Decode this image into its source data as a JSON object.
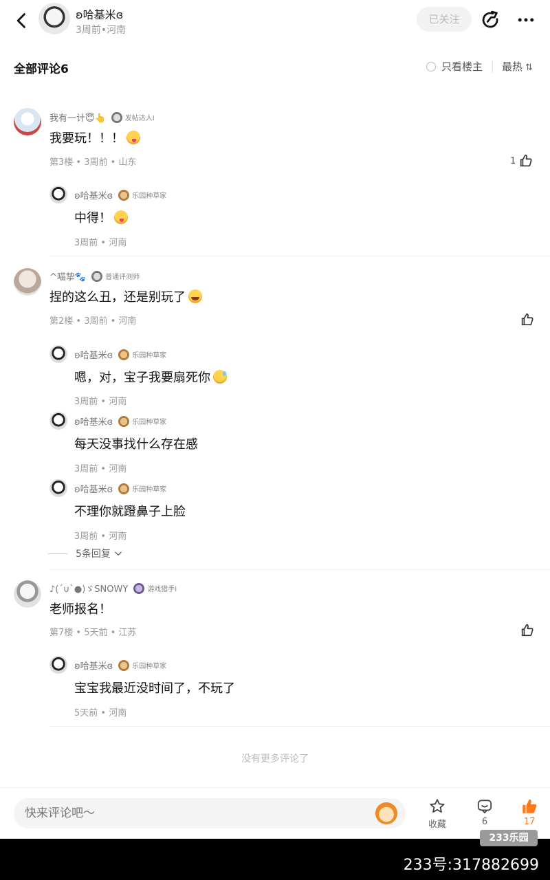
{
  "header": {
    "username": "ʚ哈基米ɞ",
    "meta": "3周前•河南",
    "follow_label": "已关注",
    "icons": [
      "back-icon",
      "share-icon",
      "more-icon"
    ]
  },
  "comments_header": {
    "title": "全部评论6",
    "only_owner": "只看楼主",
    "sort": "最热",
    "sort_icon": "⇅"
  },
  "comments": [
    {
      "username": "我有一计😇👆",
      "badge": "发帖达人I",
      "text": "我要玩！！！",
      "meta": "第3楼 • 3周前 • 山东",
      "likes": "1",
      "replies": [
        {
          "username": "ʚ哈基米ɞ",
          "badge": "乐园种草家",
          "text": "中得！",
          "meta": "3周前 • 河南"
        }
      ]
    },
    {
      "username": "^喵挚🐾",
      "badge": "普通评测师",
      "text": "捏的这么丑，还是别玩了",
      "meta": "第2楼 • 3周前 • 河南",
      "likes": "",
      "replies": [
        {
          "username": "ʚ哈基米ɞ",
          "badge": "乐园种草家",
          "text": "嗯，对，宝子我要扇死你",
          "meta": "3周前 • 河南"
        },
        {
          "username": "ʚ哈基米ɞ",
          "badge": "乐园种草家",
          "text": "每天没事找什么存在感",
          "meta": "3周前 • 河南"
        },
        {
          "username": "ʚ哈基米ɞ",
          "badge": "乐园种草家",
          "text": "不理你就蹬鼻子上脸",
          "meta": "3周前 • 河南"
        }
      ],
      "more_replies": "5条回复"
    },
    {
      "username": "♪(´∪`●)ゞSNOWY",
      "badge": "游戏猎手I",
      "text": "老师报名！",
      "meta": "第7楼 • 5天前 • 江苏",
      "likes": "",
      "replies": [
        {
          "username": "ʚ哈基米ɞ",
          "badge": "乐园种草家",
          "text": "宝宝我最近没时间了，不玩了",
          "meta": "5天前 • 河南"
        }
      ]
    }
  ],
  "end_text": "没有更多评论了",
  "bottom_bar": {
    "input_placeholder": "快来评论吧～",
    "favorite_label": "收藏",
    "comment_count": "6",
    "like_count": "17",
    "accent_color": "#ff7a1a"
  },
  "watermark": {
    "logo": "233乐园",
    "id_text": "233号:317882699"
  }
}
